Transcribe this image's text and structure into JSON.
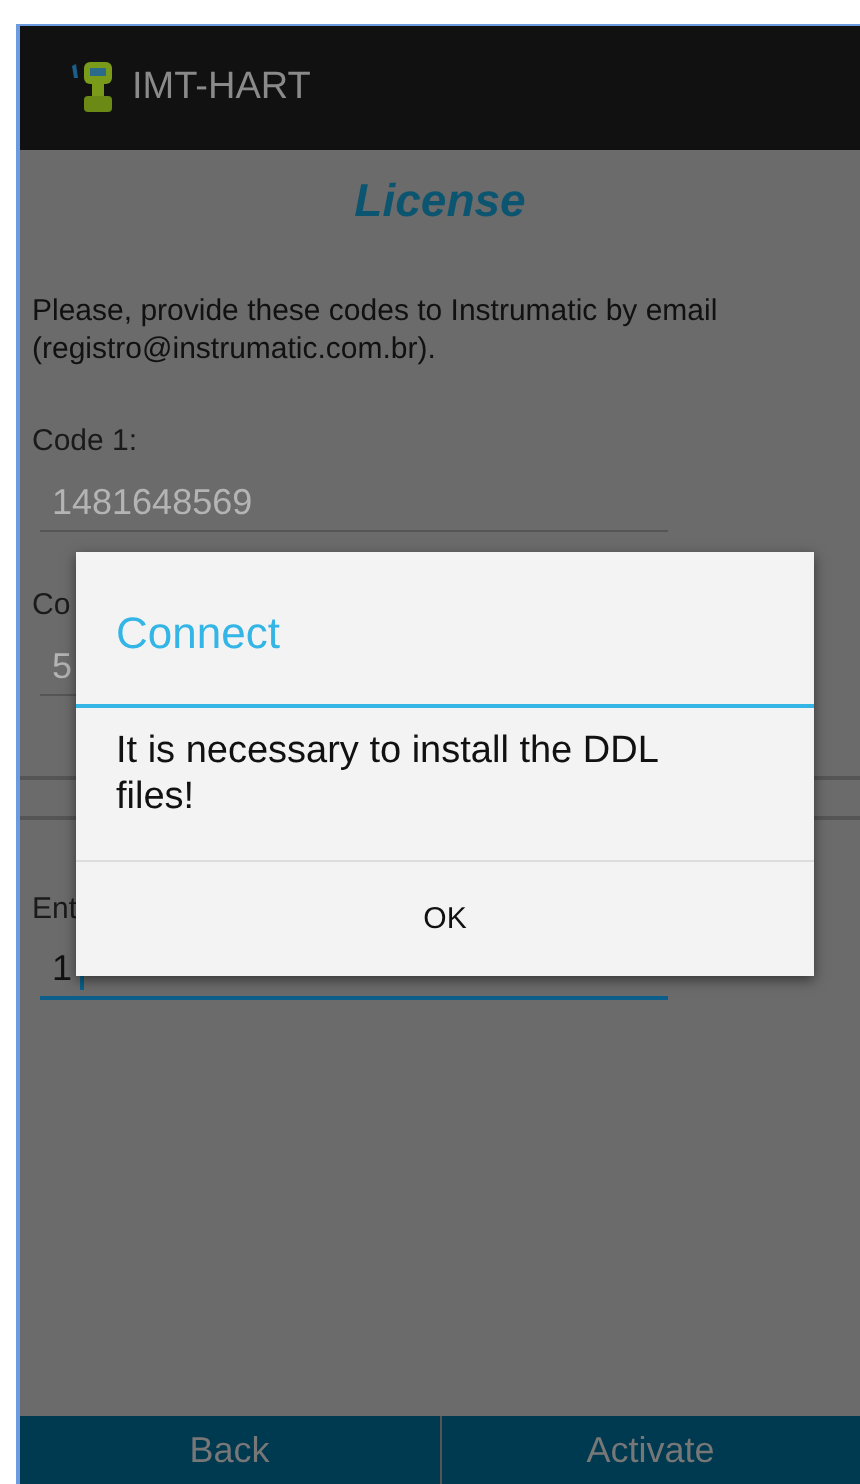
{
  "action_bar": {
    "title": "IMT-HART"
  },
  "page": {
    "title": "License",
    "instructions": "Please, provide these codes to Instrumatic by email (registro@instrumatic.com.br).",
    "fields": [
      {
        "label": "Code 1:",
        "value": "1481648569",
        "focused": false
      },
      {
        "label": "Co",
        "value": "5",
        "focused": false
      },
      {
        "label": "Ent",
        "value": "1",
        "focused": true
      }
    ]
  },
  "dialog": {
    "title": "Connect",
    "message": "It is necessary to install the DDL files!",
    "buttons": [
      "OK"
    ]
  },
  "bottom_buttons": [
    "Back",
    "Activate"
  ]
}
